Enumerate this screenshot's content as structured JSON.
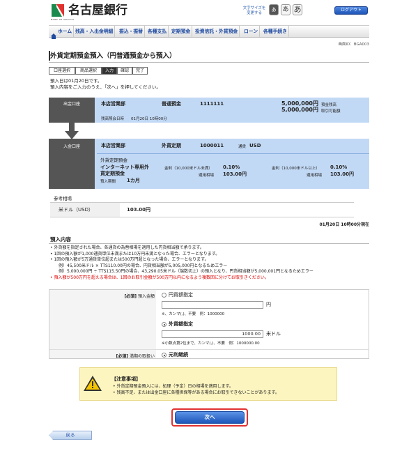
{
  "header": {
    "bank_name": "名古屋銀行",
    "logo_sub": "BANK OF NAGOYA",
    "font_size_label": "文字サイズを変更する",
    "font_sizes": [
      "あ",
      "あ",
      "あ"
    ],
    "logout_label": "ログアウト"
  },
  "nav": {
    "items": [
      "ホーム",
      "残高・入出金明細",
      "振込・振替",
      "各種支払",
      "定期預金",
      "投資信託・外貨預金",
      "ローン",
      "各種手続き"
    ]
  },
  "screen_id": "画面ID：BGA003",
  "page_title": "外貨定期預金預入（円普通預金から預入）",
  "steps": [
    "口座選択",
    "商品選択",
    "入力",
    "確認",
    "完了"
  ],
  "current_step_index": 2,
  "intro": {
    "line1": "預入日は01月20日です。",
    "line2": "預入内容をご入力のうえ、「次へ」を押してください。"
  },
  "withdraw_account": {
    "label": "出金口座",
    "branch": "本店営業部",
    "type": "普通預金",
    "number": "1111111",
    "balance": "5,000,000円",
    "balance_label": "預金残高",
    "available": "5,000,000円",
    "available_label": "取引可能額",
    "as_of_label": "残高照会日時",
    "as_of": "01月20日 10時00分"
  },
  "deposit_account": {
    "label": "入金口座",
    "branch": "本店営業部",
    "type": "外貨定期",
    "number": "1000011",
    "currency_label": "通貨",
    "currency": "USD",
    "product_header": "外貨定期預金",
    "product_name_1": "インターネット専用外",
    "product_name_2": "貨定期預金",
    "period_label": "預入期間",
    "period": "1カ月",
    "rate1_label": "金利（10,000米ドル未満）",
    "rate1": "0.10%",
    "rate1_fx_label": "適用相場",
    "rate1_fx": "103.00円",
    "rate2_label": "金利（10,000米ドル以上）",
    "rate2": "0.10%",
    "rate2_fx_label": "適用相場",
    "rate2_fx": "103.00円"
  },
  "reference_rates": {
    "title": "参考相場",
    "currency": "米ドル（USD）",
    "rate": "103.00円",
    "timestamp": "01月20日 10時00分現在"
  },
  "deposit_details": {
    "title": "預入内容",
    "notes": [
      "外貨額を指定された場合、各通貨の為替相場を適用した円貨相当額で承ります。",
      "1回の預入額が1,000通貨単位未満または10万円未満となった場合、エラーとなります。",
      "1回の預入額が5万通貨単位超または500万円超となった場合、エラーとなります。",
      "例）45,500米ドル × TTS110.00円の場合、円貨相当額が5,005,000円となるためエラー",
      "例）5,000,000円 ÷ TTS115.50円の場合、43,290.05米ドル（端数切上）の預入となり、円貨相当額が5,000,001円となるためエラー",
      "預入額が500万円を超える場合は、1回のお取引金額が500万円以内になるよう複数回に分けてお取引きください。"
    ]
  },
  "form": {
    "required": "[必須]",
    "amount_label": "預入金額",
    "yen_option": "円貨額指定",
    "yen_value": "",
    "yen_unit": "円",
    "yen_hint": "※、カンマ(,)、不要　例：1000000",
    "fx_option": "外貨額指定",
    "fx_value": "1000.00",
    "fx_unit": "米ドル",
    "fx_hint": "※小数点第2位まで、カンマ(,)、不要　例：1000000.00",
    "maturity_label": "満期の取扱い",
    "maturity_option": "元利継続"
  },
  "caution": {
    "title": "【注意事項】",
    "items": [
      "外貨定期預金預入には、処理（予定）日の相場を適用します。",
      "残高不足、または出金口座に各種担保等がある場合にお取引できないことがあります。"
    ]
  },
  "next_label": "次へ",
  "back_label": "戻る"
}
